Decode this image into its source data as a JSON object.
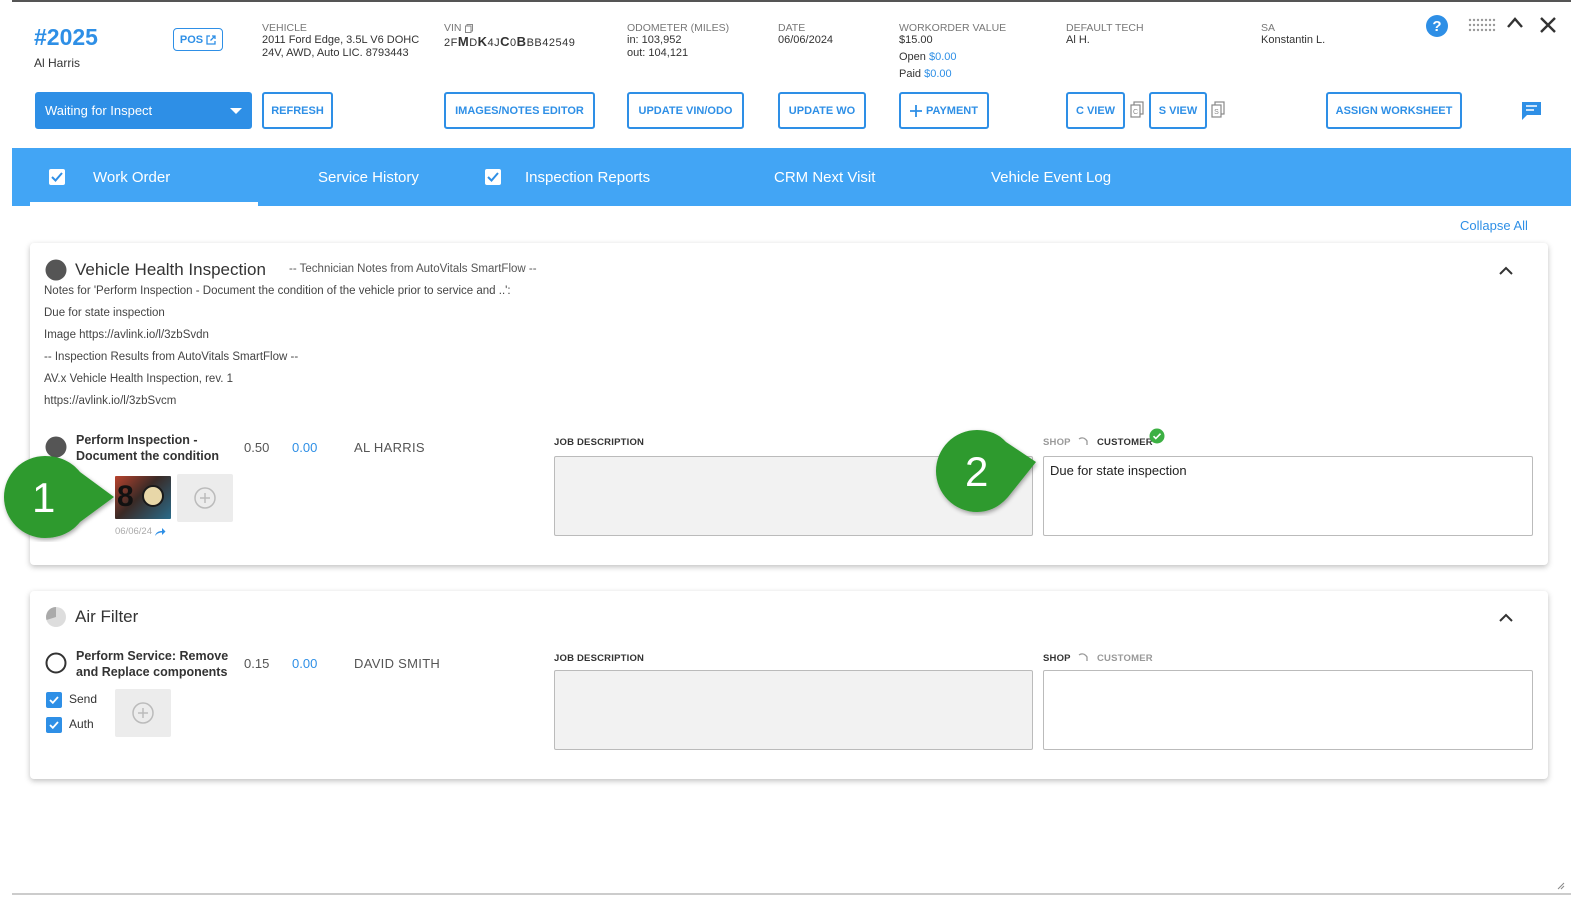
{
  "header": {
    "wo_number": "#2025",
    "customer": "Al Harris",
    "pos_label": "POS",
    "vehicle_label": "VEHICLE",
    "vehicle_line1": "2011 Ford Edge, 3.5L V6 DOHC",
    "vehicle_line2": "24V, AWD, Auto LIC. 8793443",
    "vin_label": "VIN",
    "vin_parts": [
      "2F",
      "M",
      "D",
      "K",
      "4J",
      "C",
      "0",
      "B",
      "BB42549"
    ],
    "odometer_label": "ODOMETER (MILES)",
    "odometer_in": "in: 103,952",
    "odometer_out": "out: 104,121",
    "date_label": "DATE",
    "date_value": "06/06/2024",
    "wo_value_label": "WORKORDER VALUE",
    "wo_value": "$15.00",
    "open_label": "Open",
    "open_value": "$0.00",
    "paid_label": "Paid",
    "paid_value": "$0.00",
    "tech_label": "DEFAULT TECH",
    "tech_value": "Al H.",
    "sa_label": "SA",
    "sa_value": "Konstantin L."
  },
  "toolbar": {
    "status": "Waiting for Inspect",
    "refresh": "REFRESH",
    "images_notes": "IMAGES/NOTES EDITOR",
    "update_vin": "UPDATE VIN/ODO",
    "update_wo": "UPDATE WO",
    "payment": "PAYMENT",
    "c_view": "C VIEW",
    "s_view": "S VIEW",
    "assign": "ASSIGN WORKSHEET"
  },
  "tabs": [
    "Work Order",
    "Service History",
    "Inspection Reports",
    "CRM Next Visit",
    "Vehicle Event Log"
  ],
  "collapse_all": "Collapse All",
  "section1": {
    "title": "Vehicle Health Inspection",
    "subtitle": "-- Technician Notes from AutoVitals SmartFlow --",
    "notes": [
      "Notes for 'Perform Inspection - Document the condition of the vehicle prior to service and ..':",
      "Due for state inspection",
      "Image https://avlink.io/l/3zbSvdn",
      "-- Inspection Results from AutoVitals SmartFlow --",
      "AV.x Vehicle Health Inspection, rev. 1",
      "https://avlink.io/l/3zbSvcm"
    ],
    "job_name": "Perform Inspection - Document the condition",
    "hours": "0.50",
    "price": "0.00",
    "tech": "AL HARRIS",
    "job_desc_label": "JOB DESCRIPTION",
    "shop_label": "SHOP",
    "customer_label": "CUSTOMER",
    "customer_note": "Due for state inspection",
    "image_date": "06/06/24",
    "thumb_text": "8"
  },
  "section2": {
    "title": "Air Filter",
    "job_name": "Perform Service: Remove and Replace components",
    "hours": "0.15",
    "price": "0.00",
    "tech": "DAVID SMITH",
    "job_desc_label": "JOB DESCRIPTION",
    "shop_label": "SHOP",
    "customer_label": "CUSTOMER",
    "send_label": "Send",
    "auth_label": "Auth"
  },
  "callouts": [
    "1",
    "2"
  ],
  "colors": {
    "accent": "#2e8fe6",
    "tab_bar": "#42a5f5",
    "callout": "#2e9a2e"
  }
}
